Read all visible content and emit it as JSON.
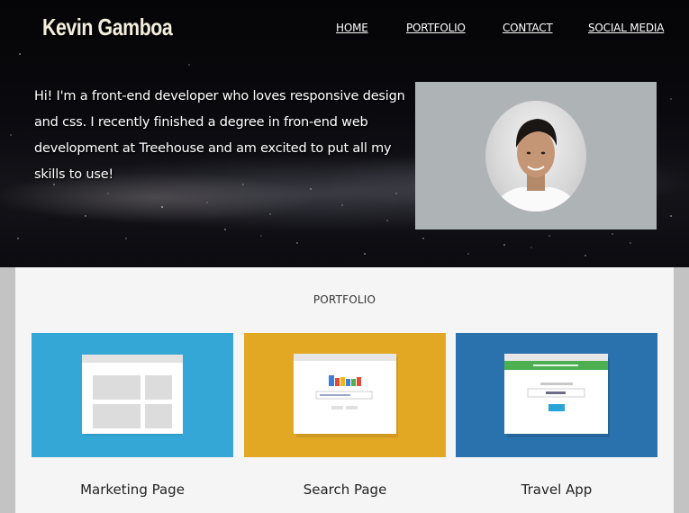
{
  "header": {
    "logo": "Kevin Gamboa",
    "nav": [
      "HOME",
      "PORTFOLIO",
      "CONTACT",
      "SOCIAL MEDIA"
    ]
  },
  "hero": {
    "intro_lines": [
      "Hi! I'm a front-end developer who loves responsive design",
      "and css. I recently finished a degree in fron-end web",
      "development at Treehouse and am excited to put all my",
      "skills to use!"
    ]
  },
  "portfolio": {
    "title": "PORTFOLIO",
    "items": [
      {
        "label": "Marketing Page",
        "color": "#35a7d6"
      },
      {
        "label": "Search Page",
        "color": "#e3a823"
      },
      {
        "label": "Travel App",
        "color": "#2a72ad"
      }
    ]
  },
  "colors": {
    "portfolio_bg": "#f5f5f5",
    "page_bg": "#c3c3c3",
    "photo_bg": "#aeb3b5"
  }
}
